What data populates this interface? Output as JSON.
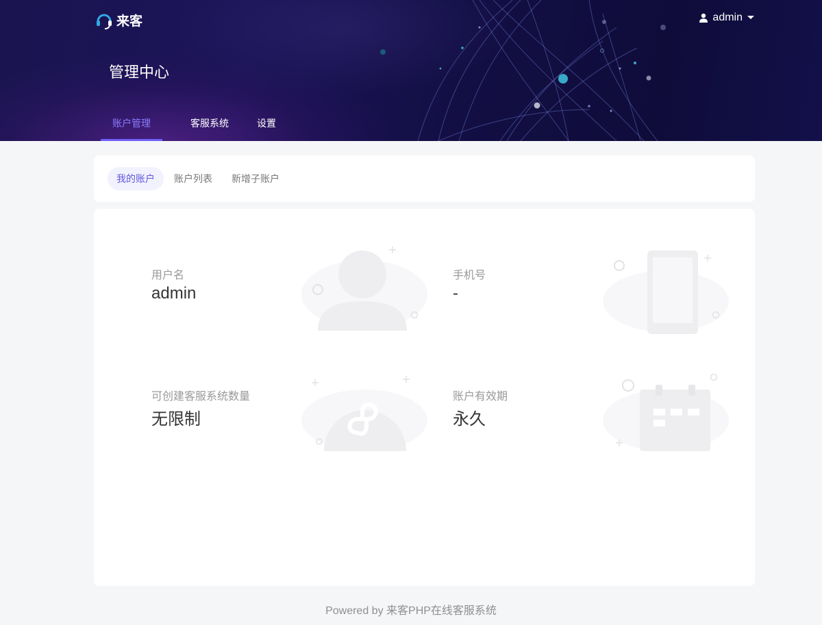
{
  "app": {
    "logo_text": "来客",
    "user": "admin",
    "page_title": "管理中心"
  },
  "main_tabs": [
    {
      "label": "账户管理",
      "active": true
    },
    {
      "label": "客服系统",
      "active": false
    },
    {
      "label": "设置",
      "active": false
    }
  ],
  "sub_tabs": [
    {
      "label": "我的账户",
      "active": true
    },
    {
      "label": "账户列表",
      "active": false
    },
    {
      "label": "新增子账户",
      "active": false
    }
  ],
  "account": {
    "username": {
      "label": "用户名",
      "value": "admin",
      "icon": "user-icon"
    },
    "phone": {
      "label": "手机号",
      "value": "-",
      "icon": "phone-icon"
    },
    "quota": {
      "label": "可创建客服系统数量",
      "value": "无限制",
      "icon": "mini-program-icon"
    },
    "validity": {
      "label": "账户有效期",
      "value": "永久",
      "icon": "calendar-icon"
    }
  },
  "footer": {
    "text": "Powered by 来客PHP在线客服系统"
  },
  "colors": {
    "accent": "#6f5ff6",
    "header_bg": "#1a1550",
    "active_subtab_bg": "#f1f2fd"
  }
}
